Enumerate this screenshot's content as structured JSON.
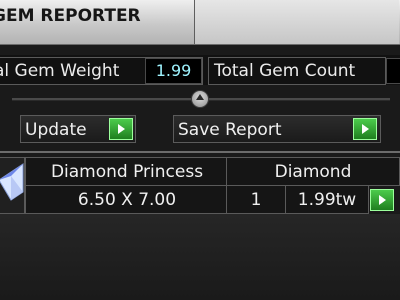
{
  "app": {
    "title": "GEM REPORTER"
  },
  "summary": {
    "weight_label": "al Gem Weight",
    "weight_value": "1.99",
    "count_label": "Total Gem Count"
  },
  "actions": {
    "update_label": "Update",
    "save_report_label": "Save Report"
  },
  "table": {
    "header": {
      "col1": "Diamond Princess",
      "col2": "Diamond"
    },
    "rows": [
      {
        "size": "6.50 X 7.00",
        "qty": "1",
        "weight": "1.99tw"
      }
    ]
  },
  "colors": {
    "value_text": "#9ff4ff",
    "go_button": "#2fa62f"
  },
  "icons": [
    "splitter-knob-icon",
    "go-arrow-icon",
    "gem-thumbnail-icon"
  ]
}
